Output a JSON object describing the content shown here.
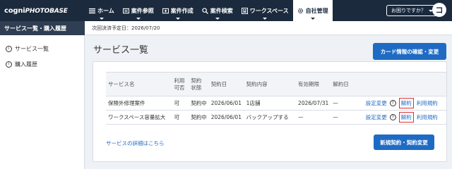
{
  "header": {
    "logo_main": "cogni",
    "logo_tag": "PHOTOBASE",
    "nav": [
      {
        "label": "ホーム",
        "icon": "list-icon"
      },
      {
        "label": "案件参照",
        "icon": "folder-icon"
      },
      {
        "label": "案件作成",
        "icon": "folder-plus-icon"
      },
      {
        "label": "案件検索",
        "icon": "search-icon"
      },
      {
        "label": "ワークスペース",
        "icon": "grid-icon"
      },
      {
        "label": "自社管理",
        "icon": "gear-icon"
      }
    ],
    "help_label": "お困りですか？",
    "avatar_letter": "コ"
  },
  "sidebar": {
    "heading": "サービス一覧・購入履歴",
    "items": [
      {
        "label": "サービス一覧",
        "icon": "info-icon"
      },
      {
        "label": "購入履歴",
        "icon": "info-icon"
      }
    ]
  },
  "infobar": {
    "text": "次回決済予定日：2026/07/20"
  },
  "main": {
    "title": "サービス一覧",
    "card_button": "カード情報の確認・変更",
    "table": {
      "headers": [
        "サービス名",
        "利用\n可否",
        "契約\n状態",
        "契約日",
        "契約内容",
        "有効期限",
        "解約日",
        ""
      ],
      "rows": [
        {
          "name": "保険外修理案件",
          "available": "可",
          "status": "契約中",
          "date": "2026/06/01",
          "content": "1店舗",
          "expiry": "2026/07/31",
          "cancel_date": "—",
          "setting": "設定変更",
          "help": "?",
          "cancel": "解約",
          "terms": "利用規約"
        },
        {
          "name": "ワークスペース容量拡大",
          "available": "可",
          "status": "契約中",
          "date": "2026/06/01",
          "content": "バックアップする",
          "expiry": "—",
          "cancel_date": "—",
          "setting": "設定変更",
          "help": "?",
          "cancel": "解約",
          "terms": "利用規約"
        }
      ]
    },
    "detail_link": "サービスの詳細はこちら",
    "new_button": "新規契約・契約変更"
  },
  "colors": {
    "nav_bg": "#1b2a3d",
    "accent": "#1f6bc4",
    "highlight": "#e03030"
  }
}
